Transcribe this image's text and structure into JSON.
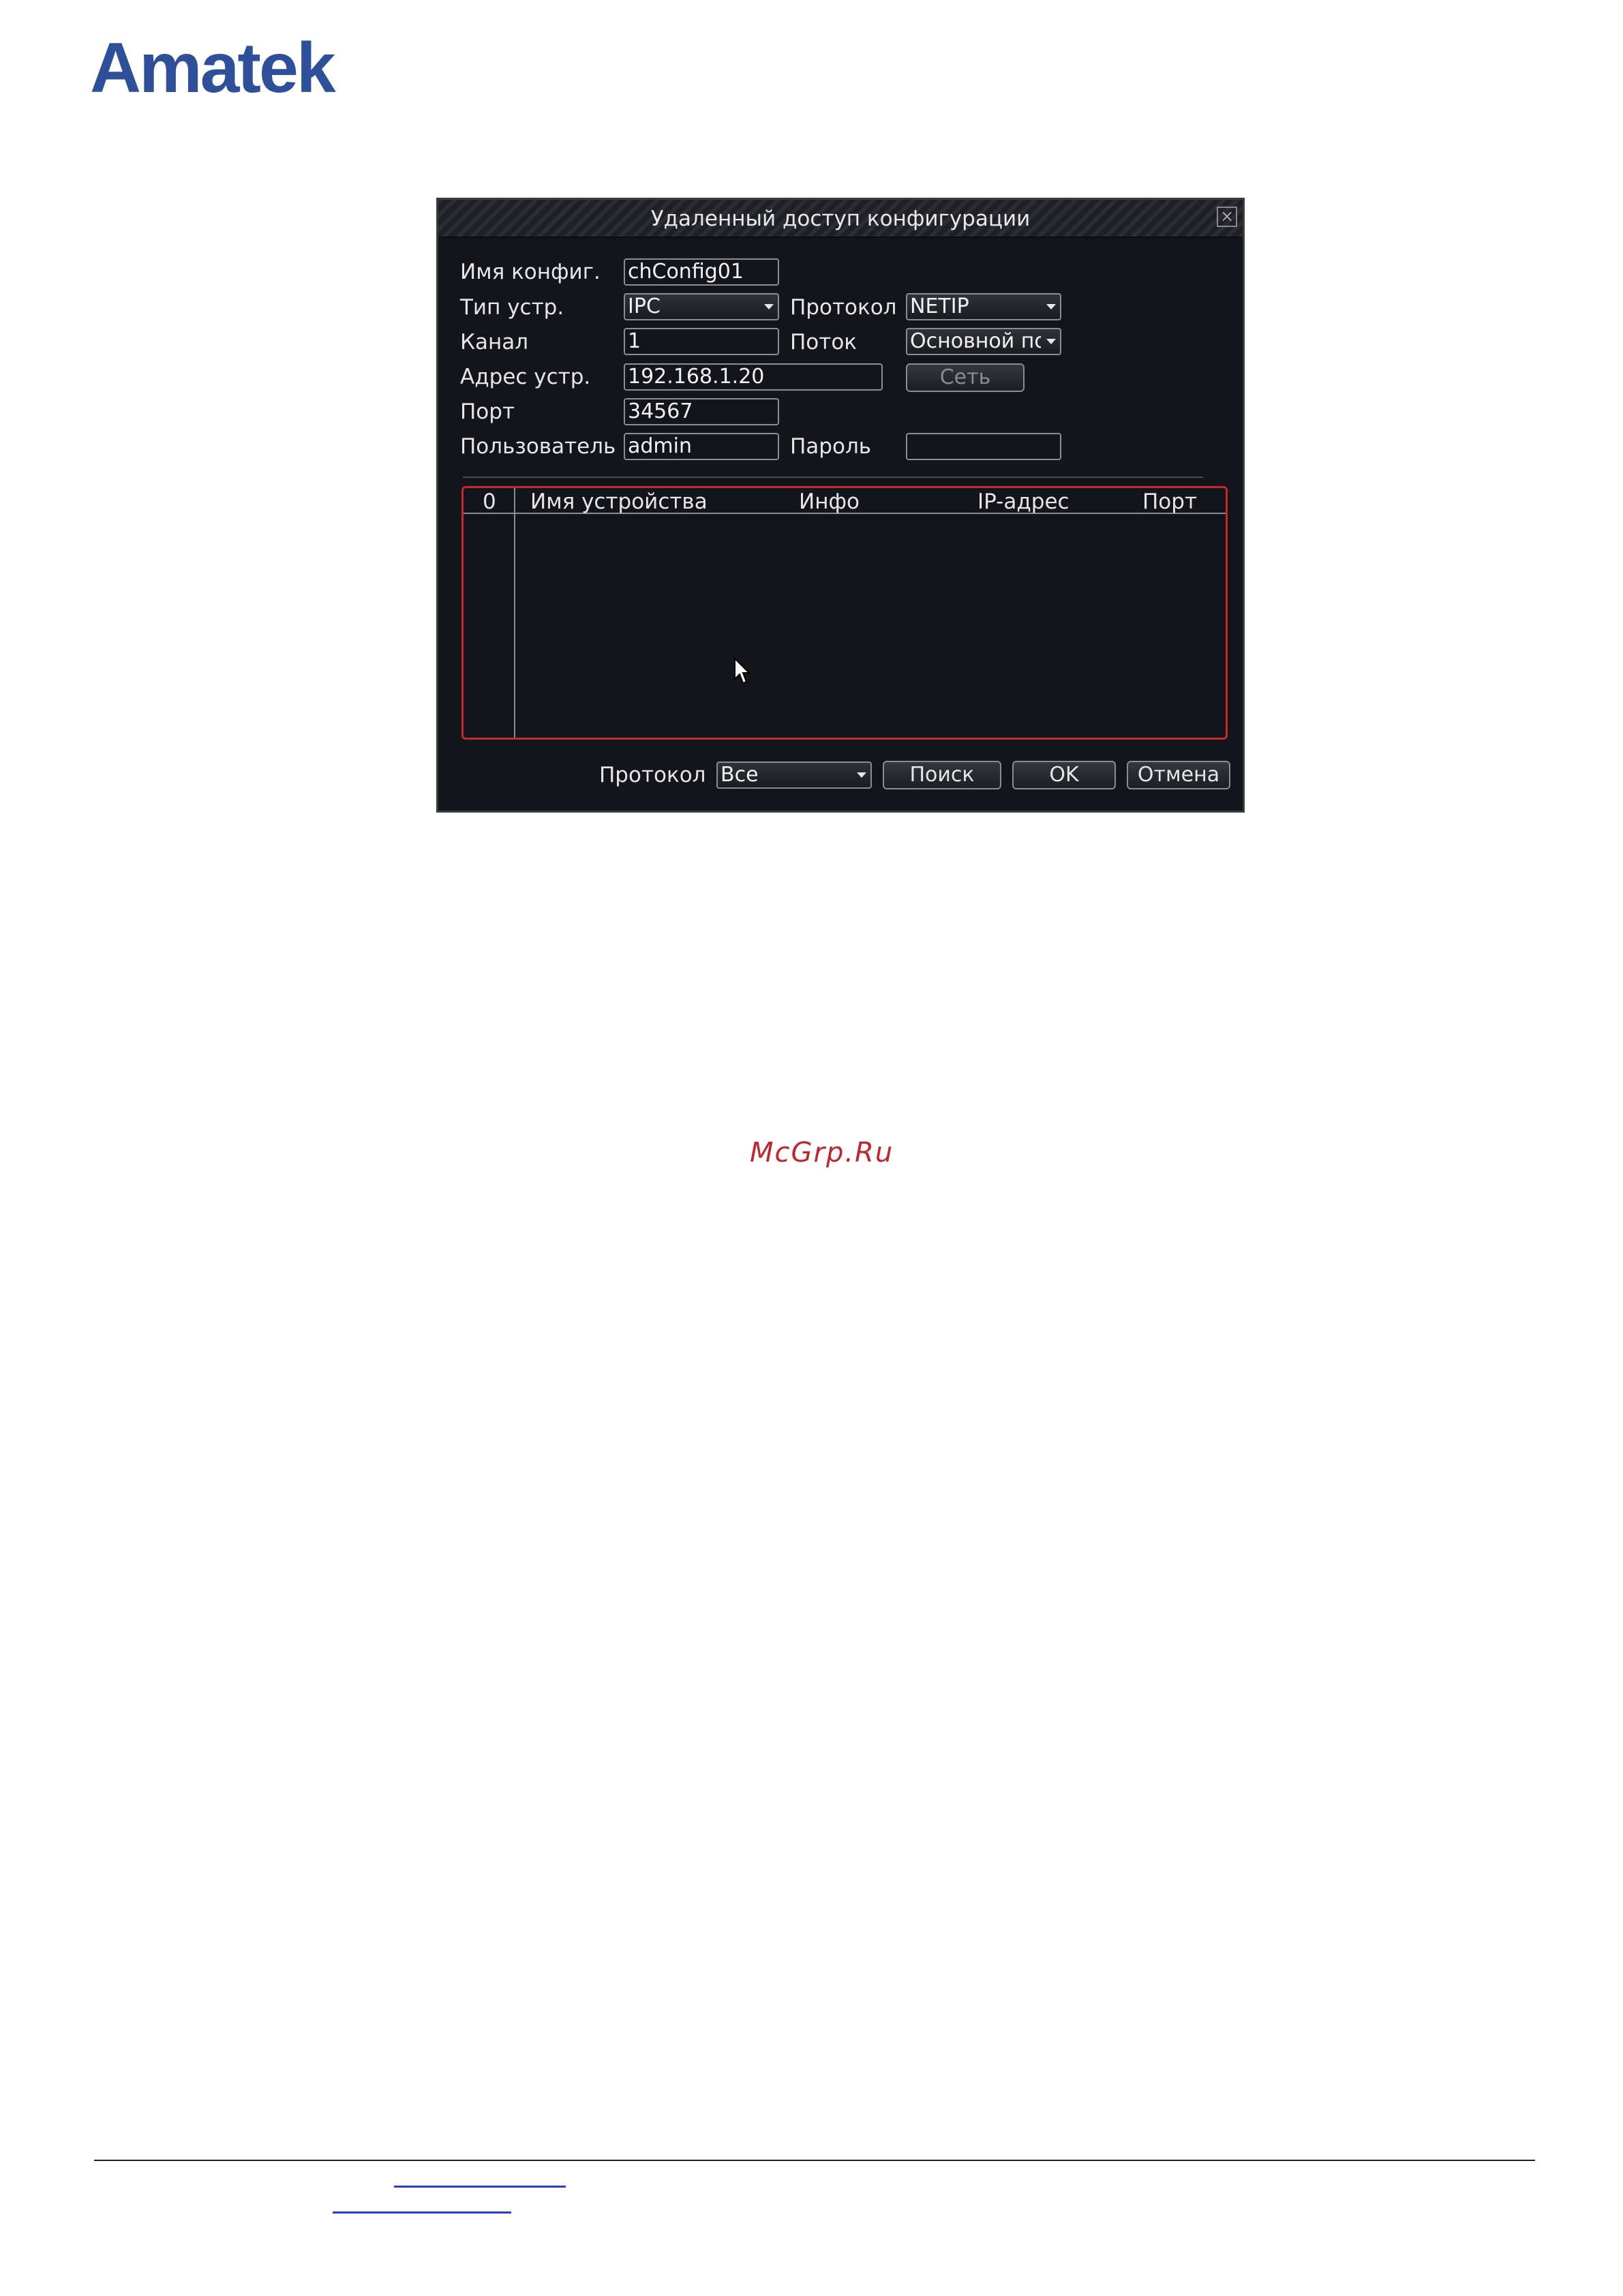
{
  "brand": {
    "logo_text": "Amatek"
  },
  "dialog": {
    "title": "Удаленный доступ конфигурации",
    "fields": {
      "config_name_label": "Имя конфиг.",
      "config_name_value": "chConfig01",
      "device_type_label": "Тип устр.",
      "device_type_value": "IPC",
      "protocol_label": "Протокол",
      "protocol_value": "NETIP",
      "channel_label": "Канал",
      "channel_value": "1",
      "stream_label": "Поток",
      "stream_value": "Основной по",
      "address_label": "Адрес устр.",
      "address_value": "192.168.1.20",
      "network_button": "Сеть",
      "port_label": "Порт",
      "port_value": "34567",
      "user_label": "Пользователь",
      "user_value": "admin",
      "password_label": "Пароль",
      "password_value": ""
    },
    "table": {
      "columns": [
        "0",
        "Имя устройства",
        "Инфо",
        "IP-адрес",
        "Порт"
      ],
      "rows": []
    },
    "bottom": {
      "protocol_label": "Протокол",
      "protocol_filter_value": "Все",
      "search_button": "Поиск",
      "ok_button": "OK",
      "cancel_button": "Отмена"
    }
  },
  "watermark": "McGrp.Ru",
  "colors": {
    "logo": "#2e4f9a",
    "dialog_bg": "#13151b",
    "list_border": "#c32a2a",
    "watermark": "#c0262b",
    "link_underline": "#2a3fc8"
  }
}
